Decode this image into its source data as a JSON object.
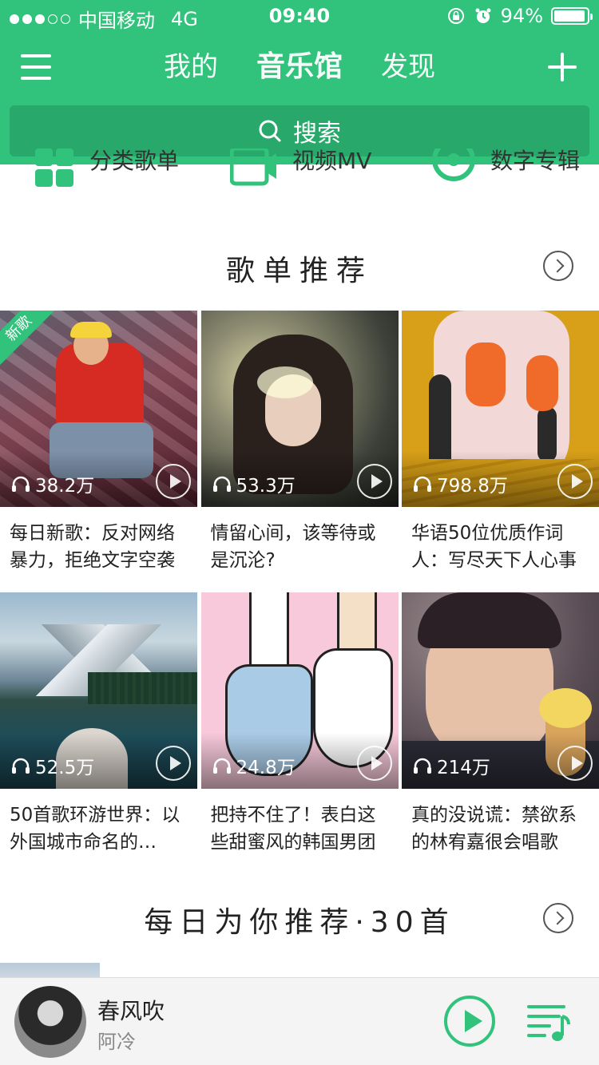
{
  "status_bar": {
    "carrier": "中国移动",
    "network": "4G",
    "time": "09:40",
    "battery": "94%",
    "battery_level": 0.94
  },
  "header": {
    "tabs": [
      {
        "label": "我的"
      },
      {
        "label": "音乐馆"
      },
      {
        "label": "发现"
      }
    ],
    "active_tab": "音乐馆",
    "search_label": "搜索"
  },
  "categories": [
    {
      "label": "分类歌单",
      "icon": "grid-icon"
    },
    {
      "label": "视频MV",
      "icon": "video-icon"
    },
    {
      "label": "数字专辑",
      "icon": "disc-icon"
    }
  ],
  "playlist_section": {
    "title": "歌单推荐",
    "items": [
      {
        "badge": "新歌",
        "plays": "38.2万",
        "title": "每日新歌：反对网络暴力，拒绝文字空袭"
      },
      {
        "badge": "",
        "plays": "53.3万",
        "title": "情留心间，该等待或是沉沦?"
      },
      {
        "badge": "",
        "plays": "798.8万",
        "title": "华语50位优质作词人：写尽天下人心事"
      },
      {
        "badge": "",
        "plays": "52.5万",
        "title": "50首歌环游世界：以外国城市命名的…"
      },
      {
        "badge": "",
        "plays": "24.8万",
        "title": "把持不住了！表白这些甜蜜风的韩国男团"
      },
      {
        "badge": "",
        "plays": "214万",
        "title": "真的没说谎：禁欲系的林宥嘉很会唱歌"
      }
    ]
  },
  "daily_section": {
    "title": "每日为你推荐·30首"
  },
  "player": {
    "song": "春风吹",
    "artist": "阿冷"
  },
  "colors": {
    "brand": "#31c27c",
    "search_bg": "#28a96b",
    "text": "#222222"
  }
}
